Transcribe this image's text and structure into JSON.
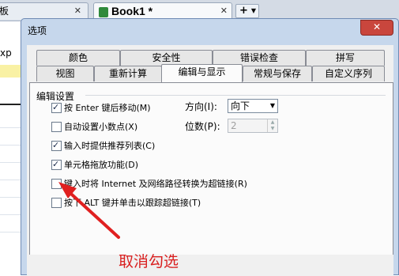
{
  "app": {
    "tab1_label": "板",
    "tab2_label": "Book1 *",
    "tab_close": "✕",
    "new_tab": "+",
    "cell_ref": "xp"
  },
  "dialog": {
    "title": "选项",
    "close_label": "✕",
    "tabs_row1": [
      "颜色",
      "安全性",
      "错误检查",
      "拼写"
    ],
    "tabs_row2": [
      "视图",
      "重新计算",
      "编辑与显示",
      "常规与保存",
      "自定义序列"
    ],
    "active_tab": "编辑与显示",
    "section": "编辑设置",
    "options": [
      {
        "label": "按 Enter 键后移动(M)",
        "checked": true
      },
      {
        "label": "自动设置小数点(X)",
        "checked": false
      },
      {
        "label": "输入时提供推荐列表(C)",
        "checked": true
      },
      {
        "label": "单元格拖放功能(D)",
        "checked": true
      },
      {
        "label": "键入时将 Internet 及网络路径转换为超链接(R)",
        "checked": false
      },
      {
        "label": "按下 ALT 键并单击以跟踪超链接(T)",
        "checked": false
      }
    ],
    "direction_label": "方向(I):",
    "direction_value": "向下",
    "places_label": "位数(P):",
    "places_value": "2"
  },
  "annotation": "取消勾选",
  "colors": {
    "arrow": "#e02020",
    "dialog_frame": "#c6d7ec"
  }
}
